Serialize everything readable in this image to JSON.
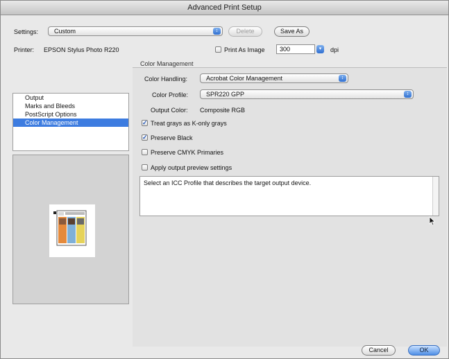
{
  "window": {
    "title": "Advanced Print Setup"
  },
  "settings": {
    "label": "Settings:",
    "value": "Custom",
    "delete_label": "Delete",
    "save_as_label": "Save As"
  },
  "printer": {
    "label": "Printer:",
    "name": "EPSON Stylus Photo R220"
  },
  "print_as_image": {
    "label": "Print As Image",
    "checked": false,
    "dpi_value": "300",
    "dpi_unit": "dpi"
  },
  "sidebar": {
    "items": [
      {
        "label": "Output",
        "selected": false
      },
      {
        "label": "Marks and Bleeds",
        "selected": false
      },
      {
        "label": "PostScript Options",
        "selected": false
      },
      {
        "label": "Color Management",
        "selected": true
      }
    ]
  },
  "color_management": {
    "section_title": "Color Management",
    "handling_label": "Color Handling:",
    "handling_value": "Acrobat Color Management",
    "profile_label": "Color Profile:",
    "profile_value": "SPR220 GPP",
    "output_color_label": "Output Color:",
    "output_color_value": "Composite RGB",
    "options": [
      {
        "label": "Treat grays as K-only grays",
        "checked": true
      },
      {
        "label": "Preserve Black",
        "checked": true
      },
      {
        "label": "Preserve CMYK Primaries",
        "checked": false
      },
      {
        "label": "Apply output preview settings",
        "checked": false
      }
    ],
    "description": "Select an ICC Profile that describes the target output device."
  },
  "footer": {
    "cancel_label": "Cancel",
    "ok_label": "OK"
  },
  "colors": {
    "accent": "#3d7ce0",
    "window_bg": "#e9e9e9"
  }
}
